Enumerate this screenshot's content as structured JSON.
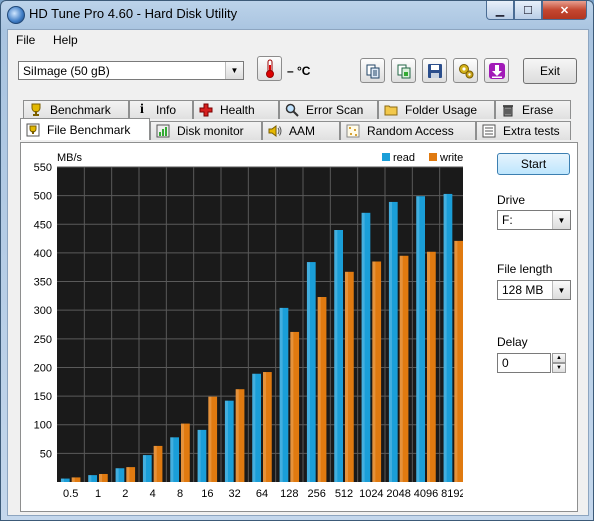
{
  "window": {
    "title": "HD Tune Pro 4.60 - Hard Disk Utility"
  },
  "menu": {
    "file": "File",
    "help": "Help"
  },
  "toolbar": {
    "drive_select": "SiImage  (50 gB)",
    "temperature": "– °C",
    "exit_label": "Exit",
    "icons": [
      "copy-text-icon",
      "copy-screenshot-icon",
      "save-icon",
      "options-icon",
      "download-icon"
    ]
  },
  "tabs_top": [
    {
      "label": "Benchmark",
      "icon": "trophy-icon"
    },
    {
      "label": "Info",
      "icon": "info-icon"
    },
    {
      "label": "Health",
      "icon": "health-cross-icon"
    },
    {
      "label": "Error Scan",
      "icon": "magnifier-icon"
    },
    {
      "label": "Folder Usage",
      "icon": "folder-icon"
    },
    {
      "label": "Erase",
      "icon": "trash-icon"
    }
  ],
  "tabs_bottom": [
    {
      "label": "File Benchmark",
      "icon": "file-benchmark-icon"
    },
    {
      "label": "Disk monitor",
      "icon": "disk-monitor-icon"
    },
    {
      "label": "AAM",
      "icon": "speaker-icon"
    },
    {
      "label": "Random Access",
      "icon": "random-access-icon"
    },
    {
      "label": "Extra tests",
      "icon": "extra-tests-icon"
    }
  ],
  "controls": {
    "start_label": "Start",
    "drive_label": "Drive",
    "drive_value": "F:",
    "file_length_label": "File length",
    "file_length_value": "128 MB",
    "delay_label": "Delay",
    "delay_value": "0"
  },
  "colors": {
    "read": "#1a9ed8",
    "write": "#e07a10",
    "plot_bg": "#1a1a1a",
    "grid": "#5a5a5a"
  },
  "chart_data": {
    "type": "bar",
    "ylabel": "MB/s",
    "ylim": [
      0,
      550
    ],
    "yticks": [
      50,
      100,
      150,
      200,
      250,
      300,
      350,
      400,
      450,
      500,
      550
    ],
    "categories": [
      "0.5",
      "1",
      "2",
      "4",
      "8",
      "16",
      "32",
      "64",
      "128",
      "256",
      "512",
      "1024",
      "2048",
      "4096",
      "8192"
    ],
    "legend": "top-right",
    "series": [
      {
        "name": "read",
        "values": [
          6,
          12,
          24,
          47,
          78,
          91,
          142,
          189,
          304,
          384,
          440,
          470,
          489,
          499,
          503
        ]
      },
      {
        "name": "write",
        "values": [
          8,
          14,
          26,
          63,
          102,
          149,
          162,
          192,
          262,
          323,
          367,
          385,
          395,
          402,
          421
        ]
      }
    ]
  }
}
